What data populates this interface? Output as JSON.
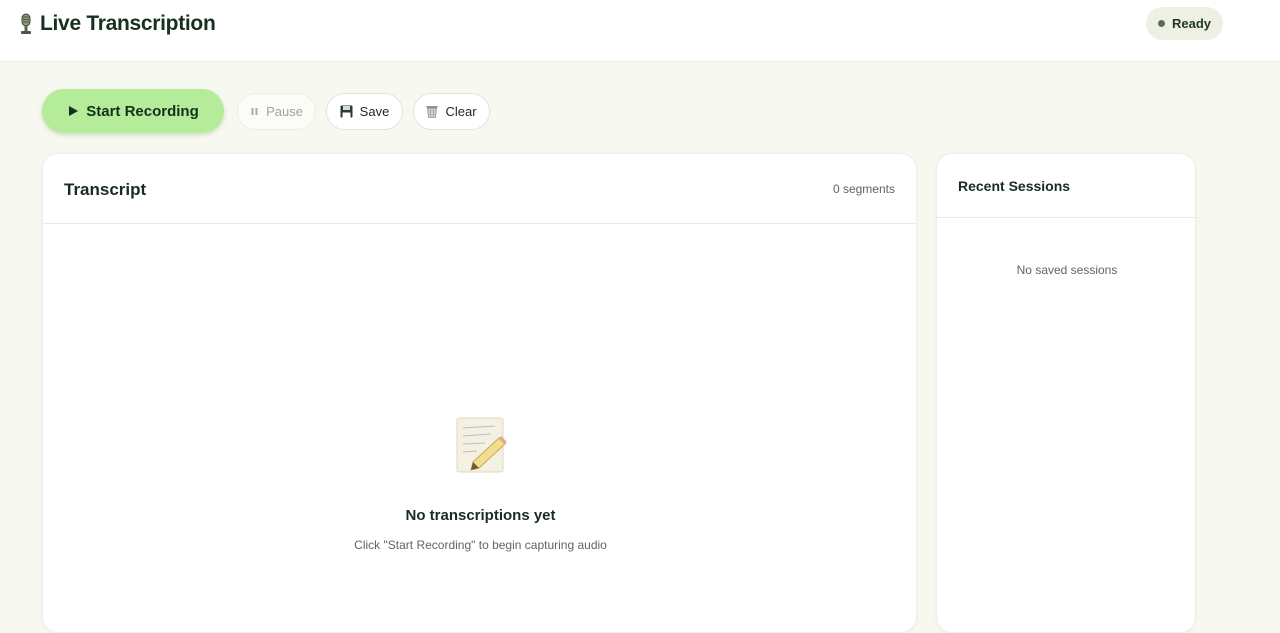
{
  "header": {
    "title": "Live Transcription",
    "status": "Ready"
  },
  "toolbar": {
    "start_label": "Start Recording",
    "pause_label": "Pause",
    "save_label": "Save",
    "clear_label": "Clear"
  },
  "transcript": {
    "title": "Transcript",
    "segments": "0 segments",
    "empty_title": "No transcriptions yet",
    "empty_subtitle": "Click \"Start Recording\" to begin capturing audio"
  },
  "sessions": {
    "title": "Recent Sessions",
    "empty": "No saved sessions"
  },
  "icons": {
    "brand": "microphone-icon",
    "start": "play-icon",
    "pause": "pause-icon",
    "save": "floppy-disk-icon",
    "clear": "trash-icon",
    "empty": "memo-pencil-icon"
  },
  "colors": {
    "accent": "#b5ec9a",
    "background": "#f7f8ef",
    "status_dot": "#5c6b60"
  }
}
